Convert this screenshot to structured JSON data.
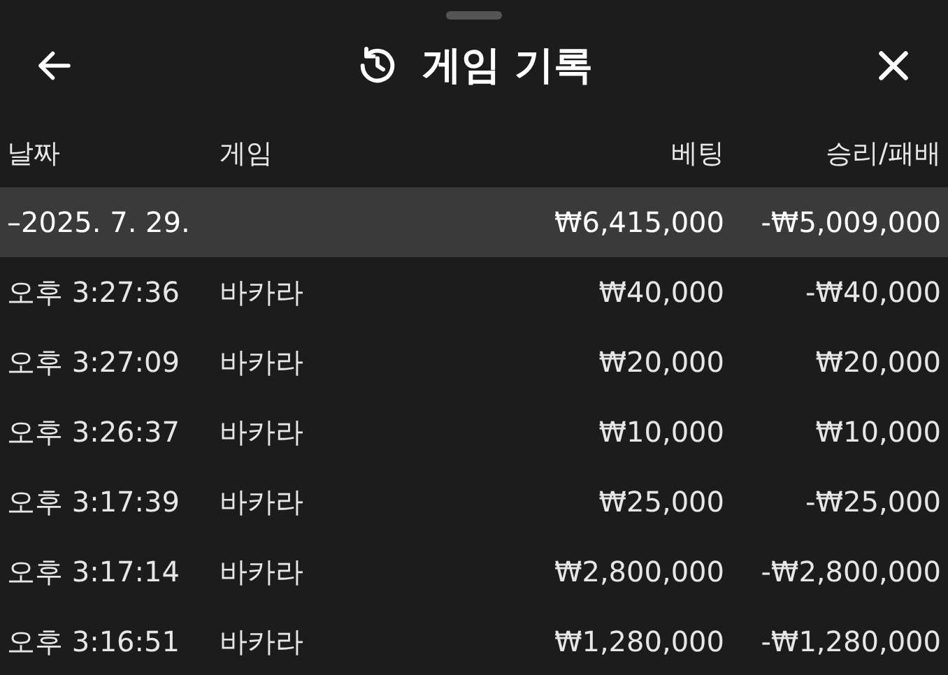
{
  "header": {
    "title": "게임 기록"
  },
  "columns": [
    "날짜",
    "게임",
    "베팅",
    "승리/패배"
  ],
  "group": {
    "date": "–2025. 7. 29.",
    "bet": "₩6,415,000",
    "result": "-₩5,009,000"
  },
  "rows": [
    {
      "time": "오후 3:27:36",
      "game": "바카라",
      "bet": "₩40,000",
      "result": "-₩40,000"
    },
    {
      "time": "오후 3:27:09",
      "game": "바카라",
      "bet": "₩20,000",
      "result": "₩20,000"
    },
    {
      "time": "오후 3:26:37",
      "game": "바카라",
      "bet": "₩10,000",
      "result": "₩10,000"
    },
    {
      "time": "오후 3:17:39",
      "game": "바카라",
      "bet": "₩25,000",
      "result": "-₩25,000"
    },
    {
      "time": "오후 3:17:14",
      "game": "바카라",
      "bet": "₩2,800,000",
      "result": "-₩2,800,000"
    },
    {
      "time": "오후 3:16:51",
      "game": "바카라",
      "bet": "₩1,280,000",
      "result": "-₩1,280,000"
    }
  ]
}
